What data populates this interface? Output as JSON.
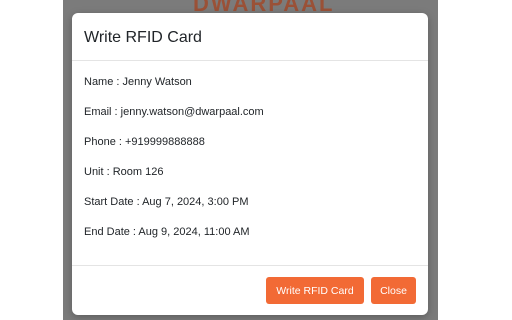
{
  "background": {
    "brand_text": "DWARPAAL"
  },
  "modal": {
    "title": "Write RFID Card",
    "fields": [
      {
        "label": "Name",
        "value": "Jenny Watson",
        "text": "Name : Jenny Watson"
      },
      {
        "label": "Email",
        "value": "jenny.watson@dwarpaal.com",
        "text": "Email : jenny.watson@dwarpaal.com"
      },
      {
        "label": "Phone",
        "value": "+919999888888",
        "text": "Phone : +919999888888"
      },
      {
        "label": "Unit",
        "value": "Room 126",
        "text": "Unit : Room 126"
      },
      {
        "label": "Start Date",
        "value": "Aug 7, 2024, 3:00 PM",
        "text": "Start Date : Aug 7, 2024, 3:00 PM"
      },
      {
        "label": "End Date",
        "value": "Aug 9, 2024, 11:00 AM",
        "text": "End Date : Aug 9, 2024, 11:00 AM"
      }
    ],
    "buttons": {
      "write_label": "Write RFID Card",
      "close_label": "Close"
    }
  },
  "colors": {
    "accent": "#f26a35",
    "backdrop": "#7b7b7b",
    "text": "#212529"
  }
}
